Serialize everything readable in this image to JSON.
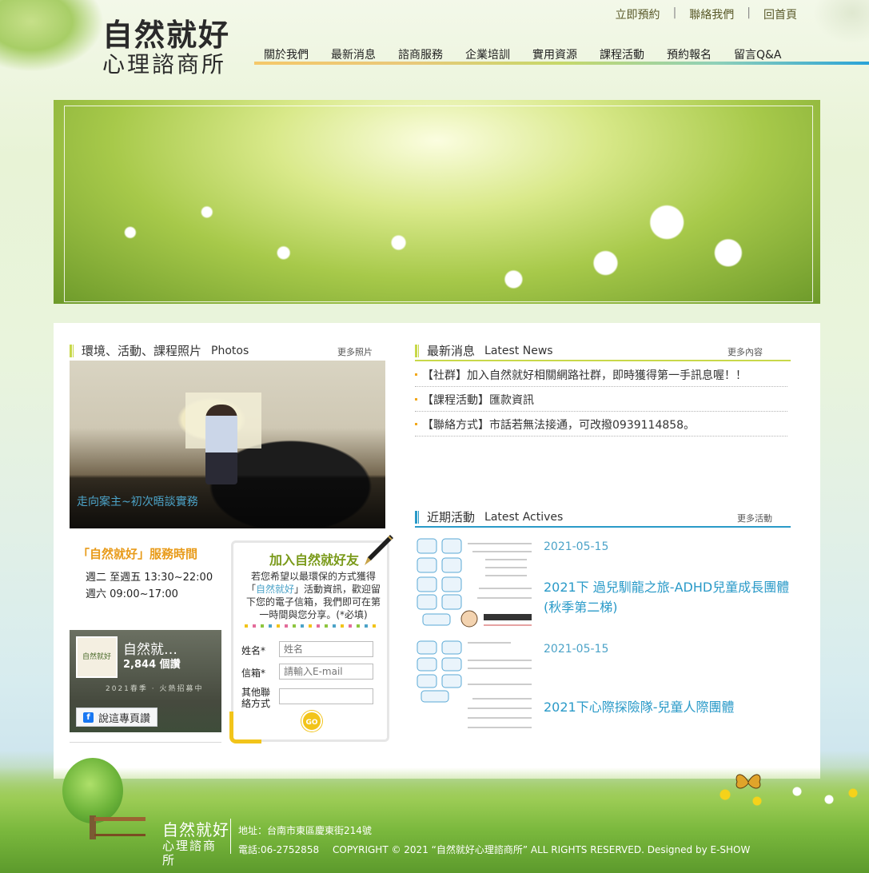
{
  "header": {
    "logo_line1": "自然就好",
    "logo_line2": "心理諮商所",
    "toplinks": [
      "立即預約",
      "聯絡我們",
      "回首頁"
    ],
    "toplink_sep": "|",
    "nav": [
      "關於我們",
      "最新消息",
      "諮商服務",
      "企業培訓",
      "實用資源",
      "課程活動",
      "預約報名",
      "留言Q&A"
    ]
  },
  "photos": {
    "title": "環境、活動、課程照片",
    "title_en": "Photos",
    "more": "更多照片",
    "caption": "走向案主~初次晤談實務"
  },
  "hours": {
    "title": "「自然就好」服務時間",
    "lines": [
      "週二  至週五 13:30~22:00",
      "週六  09:00~17:00"
    ]
  },
  "facebook": {
    "thumb_text": "自然就好",
    "name": "自然就…",
    "reads": "2,844 個讚",
    "tagline": "2021春季 · 火熱招募中",
    "like_label": "說這專頁讚",
    "fb_glyph": "f"
  },
  "join": {
    "title": "加入自然就好友",
    "desc_before": "若您希望以最環保的方式獲得「",
    "desc_highlight": "自然就好",
    "desc_after": "」活動資訊，歡迎留下您的電子信箱，我們即可在第一時間與您分享。(*必填)",
    "name_label": "姓名*",
    "name_placeholder": "姓名",
    "email_label": "信箱*",
    "email_placeholder": "請輸入E-mail",
    "other_label": "其他聯絡方式",
    "go_label": "GO"
  },
  "news": {
    "title": "最新消息",
    "title_en": "Latest News",
    "more": "更多內容",
    "items": [
      "【社群】加入自然就好相關網路社群，即時獲得第一手訊息喔！！",
      "【課程活動】匯款資訊",
      "【聯絡方式】市話若無法接通，可改撥0939114858。"
    ]
  },
  "activities": {
    "title": "近期活動",
    "title_en": "Latest Actives",
    "more": "更多活動",
    "items": [
      {
        "date": "2021-05-15",
        "title": "2021下 過兒馴龍之旅-ADHD兒童成長團體(秋季第二梯)"
      },
      {
        "date": "2021-05-15",
        "title": "2021下心際探險隊-兒童人際團體"
      }
    ]
  },
  "footer": {
    "logo_line1": "自然就好",
    "logo_line2": "心理諮商所",
    "address": "地址：台南市東區慶東街214號",
    "phone": "電話:06-2752858",
    "copyright": "COPYRIGHT © 2021 “自然就好心理諮商所” ALL RIGHTS RESERVED. Designed by E-SHOW"
  },
  "colors": {
    "accent_green": "#c8d84a",
    "accent_orange": "#e89b1a",
    "accent_blue": "#2a9ac8"
  }
}
